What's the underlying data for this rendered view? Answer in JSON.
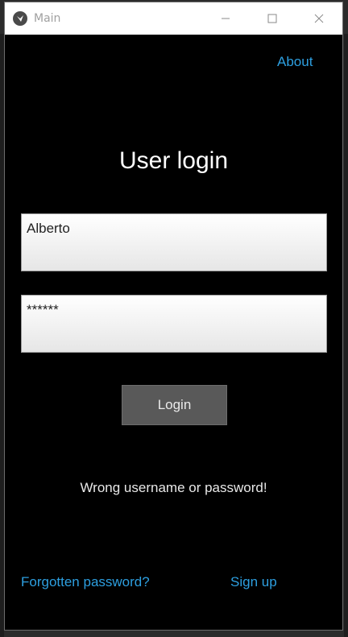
{
  "window": {
    "title": "Main"
  },
  "header": {
    "about_label": "About"
  },
  "main": {
    "heading": "User login",
    "username_value": "Alberto",
    "password_value": "******",
    "login_label": "Login",
    "error_message": "Wrong username or password!"
  },
  "footer": {
    "forgot_label": "Forgotten password?",
    "signup_label": "Sign up"
  },
  "colors": {
    "link": "#2d9fe0",
    "background": "#000000",
    "button": "#595959"
  },
  "icons": {
    "app": "kivy-app-icon",
    "minimize": "minimize-icon",
    "maximize": "maximize-icon",
    "close": "close-icon"
  }
}
